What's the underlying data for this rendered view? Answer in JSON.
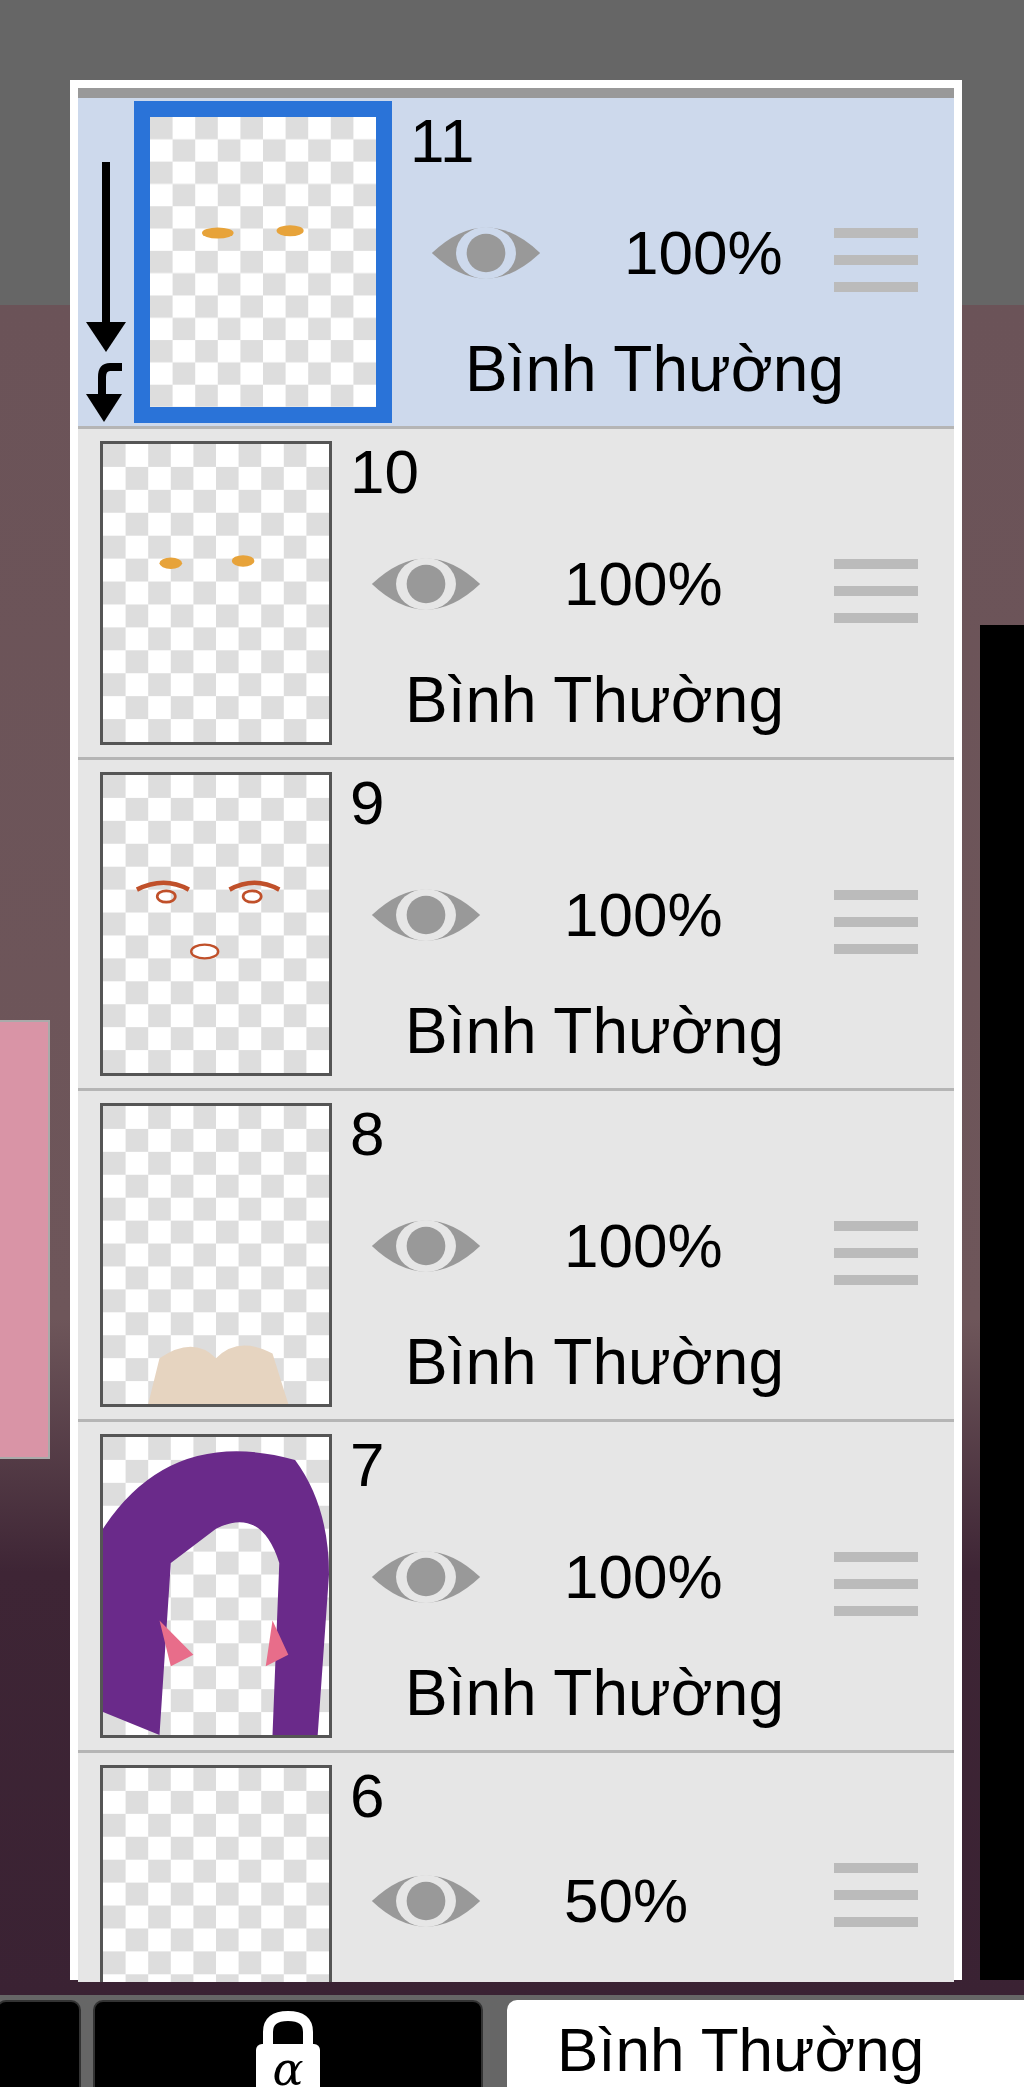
{
  "layers": [
    {
      "number": "11",
      "opacity": "100%",
      "mode": "Bình Thường",
      "selected": true,
      "clipped": true
    },
    {
      "number": "10",
      "opacity": "100%",
      "mode": "Bình Thường",
      "selected": false,
      "clipped": false
    },
    {
      "number": "9",
      "opacity": "100%",
      "mode": "Bình Thường",
      "selected": false,
      "clipped": false
    },
    {
      "number": "8",
      "opacity": "100%",
      "mode": "Bình Thường",
      "selected": false,
      "clipped": false
    },
    {
      "number": "7",
      "opacity": "100%",
      "mode": "Bình Thường",
      "selected": false,
      "clipped": false
    },
    {
      "number": "6",
      "opacity": "50%",
      "selected": false,
      "clipped": false
    }
  ],
  "bottom_bar": {
    "lock_alpha": "α",
    "blend_mode": "Bình Thường"
  }
}
